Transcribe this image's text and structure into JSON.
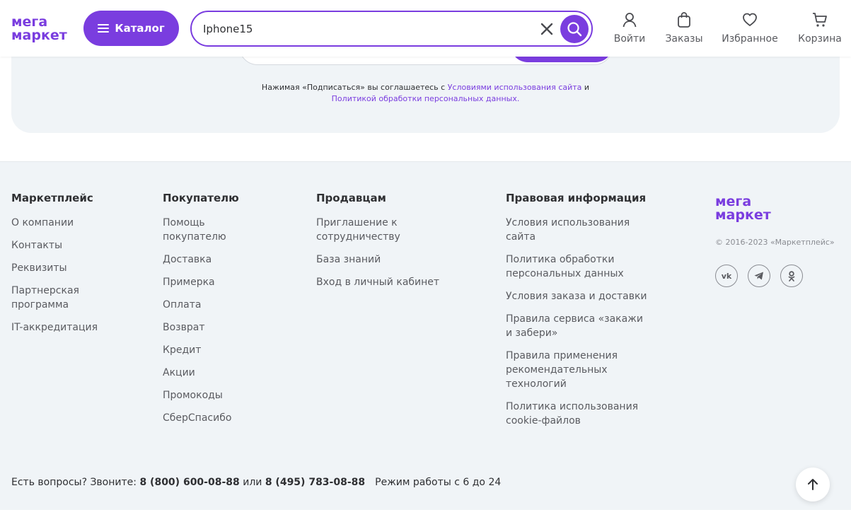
{
  "header": {
    "logo_line1": "мега",
    "logo_line2": "маркет",
    "catalog_label": "Каталог",
    "search_value": "Iphone15",
    "nav": [
      {
        "label": "Войти",
        "icon": "user-icon"
      },
      {
        "label": "Заказы",
        "icon": "bag-icon"
      },
      {
        "label": "Избранное",
        "icon": "heart-icon"
      },
      {
        "label": "Корзина",
        "icon": "cart-icon"
      }
    ]
  },
  "subscribe": {
    "consent_text": "Нажимая «Подписаться» вы соглашаетесь с ",
    "terms_link": "Условиями использования сайта",
    "and": " и",
    "privacy_link": "Политикой обработки персональных данных."
  },
  "footer": {
    "columns": [
      {
        "title": "Маркетплейс",
        "items": [
          "О компании",
          "Контакты",
          "Реквизиты",
          "Партнерская программа",
          "IT-аккредитация"
        ]
      },
      {
        "title": "Покупателю",
        "items": [
          "Помощь покупателю",
          "Доставка",
          "Примерка",
          "Оплата",
          "Возврат",
          "Кредит",
          "Акции",
          "Промокоды",
          "СберСпасибо"
        ]
      },
      {
        "title": "Продавцам",
        "items": [
          "Приглашение к сотрудничеству",
          "База знаний",
          "Вход в личный кабинет"
        ]
      },
      {
        "title": "Правовая информация",
        "items": [
          "Условия использования сайта",
          "Политика обработки персональных данных",
          "Условия заказа и доставки",
          "Правила сервиса «закажи и забери»",
          "Правила применения рекомендательных технологий",
          "Политика использования cookie-файлов"
        ]
      }
    ],
    "brand": {
      "logo_line1": "мега",
      "logo_line2": "маркет",
      "copyright": "© 2016-2023 «Маркетплейс»",
      "socials": [
        {
          "name": "vk-icon",
          "glyph": "vk"
        },
        {
          "name": "telegram-icon",
          "glyph": ""
        },
        {
          "name": "odnoklassniki-icon",
          "glyph": ""
        }
      ]
    },
    "contacts": {
      "prefix": "Есть вопросы? Звоните: ",
      "phone1": "8 (800) 600-08-88",
      "or": " или ",
      "phone2": "8 (495) 783-08-88",
      "hours": "Режим работы с 6 до 24"
    }
  },
  "colors": {
    "accent": "#7a3ddf",
    "footer_bg": "#f0f4f7",
    "text": "#2f3033",
    "muted": "#5a5b60"
  }
}
